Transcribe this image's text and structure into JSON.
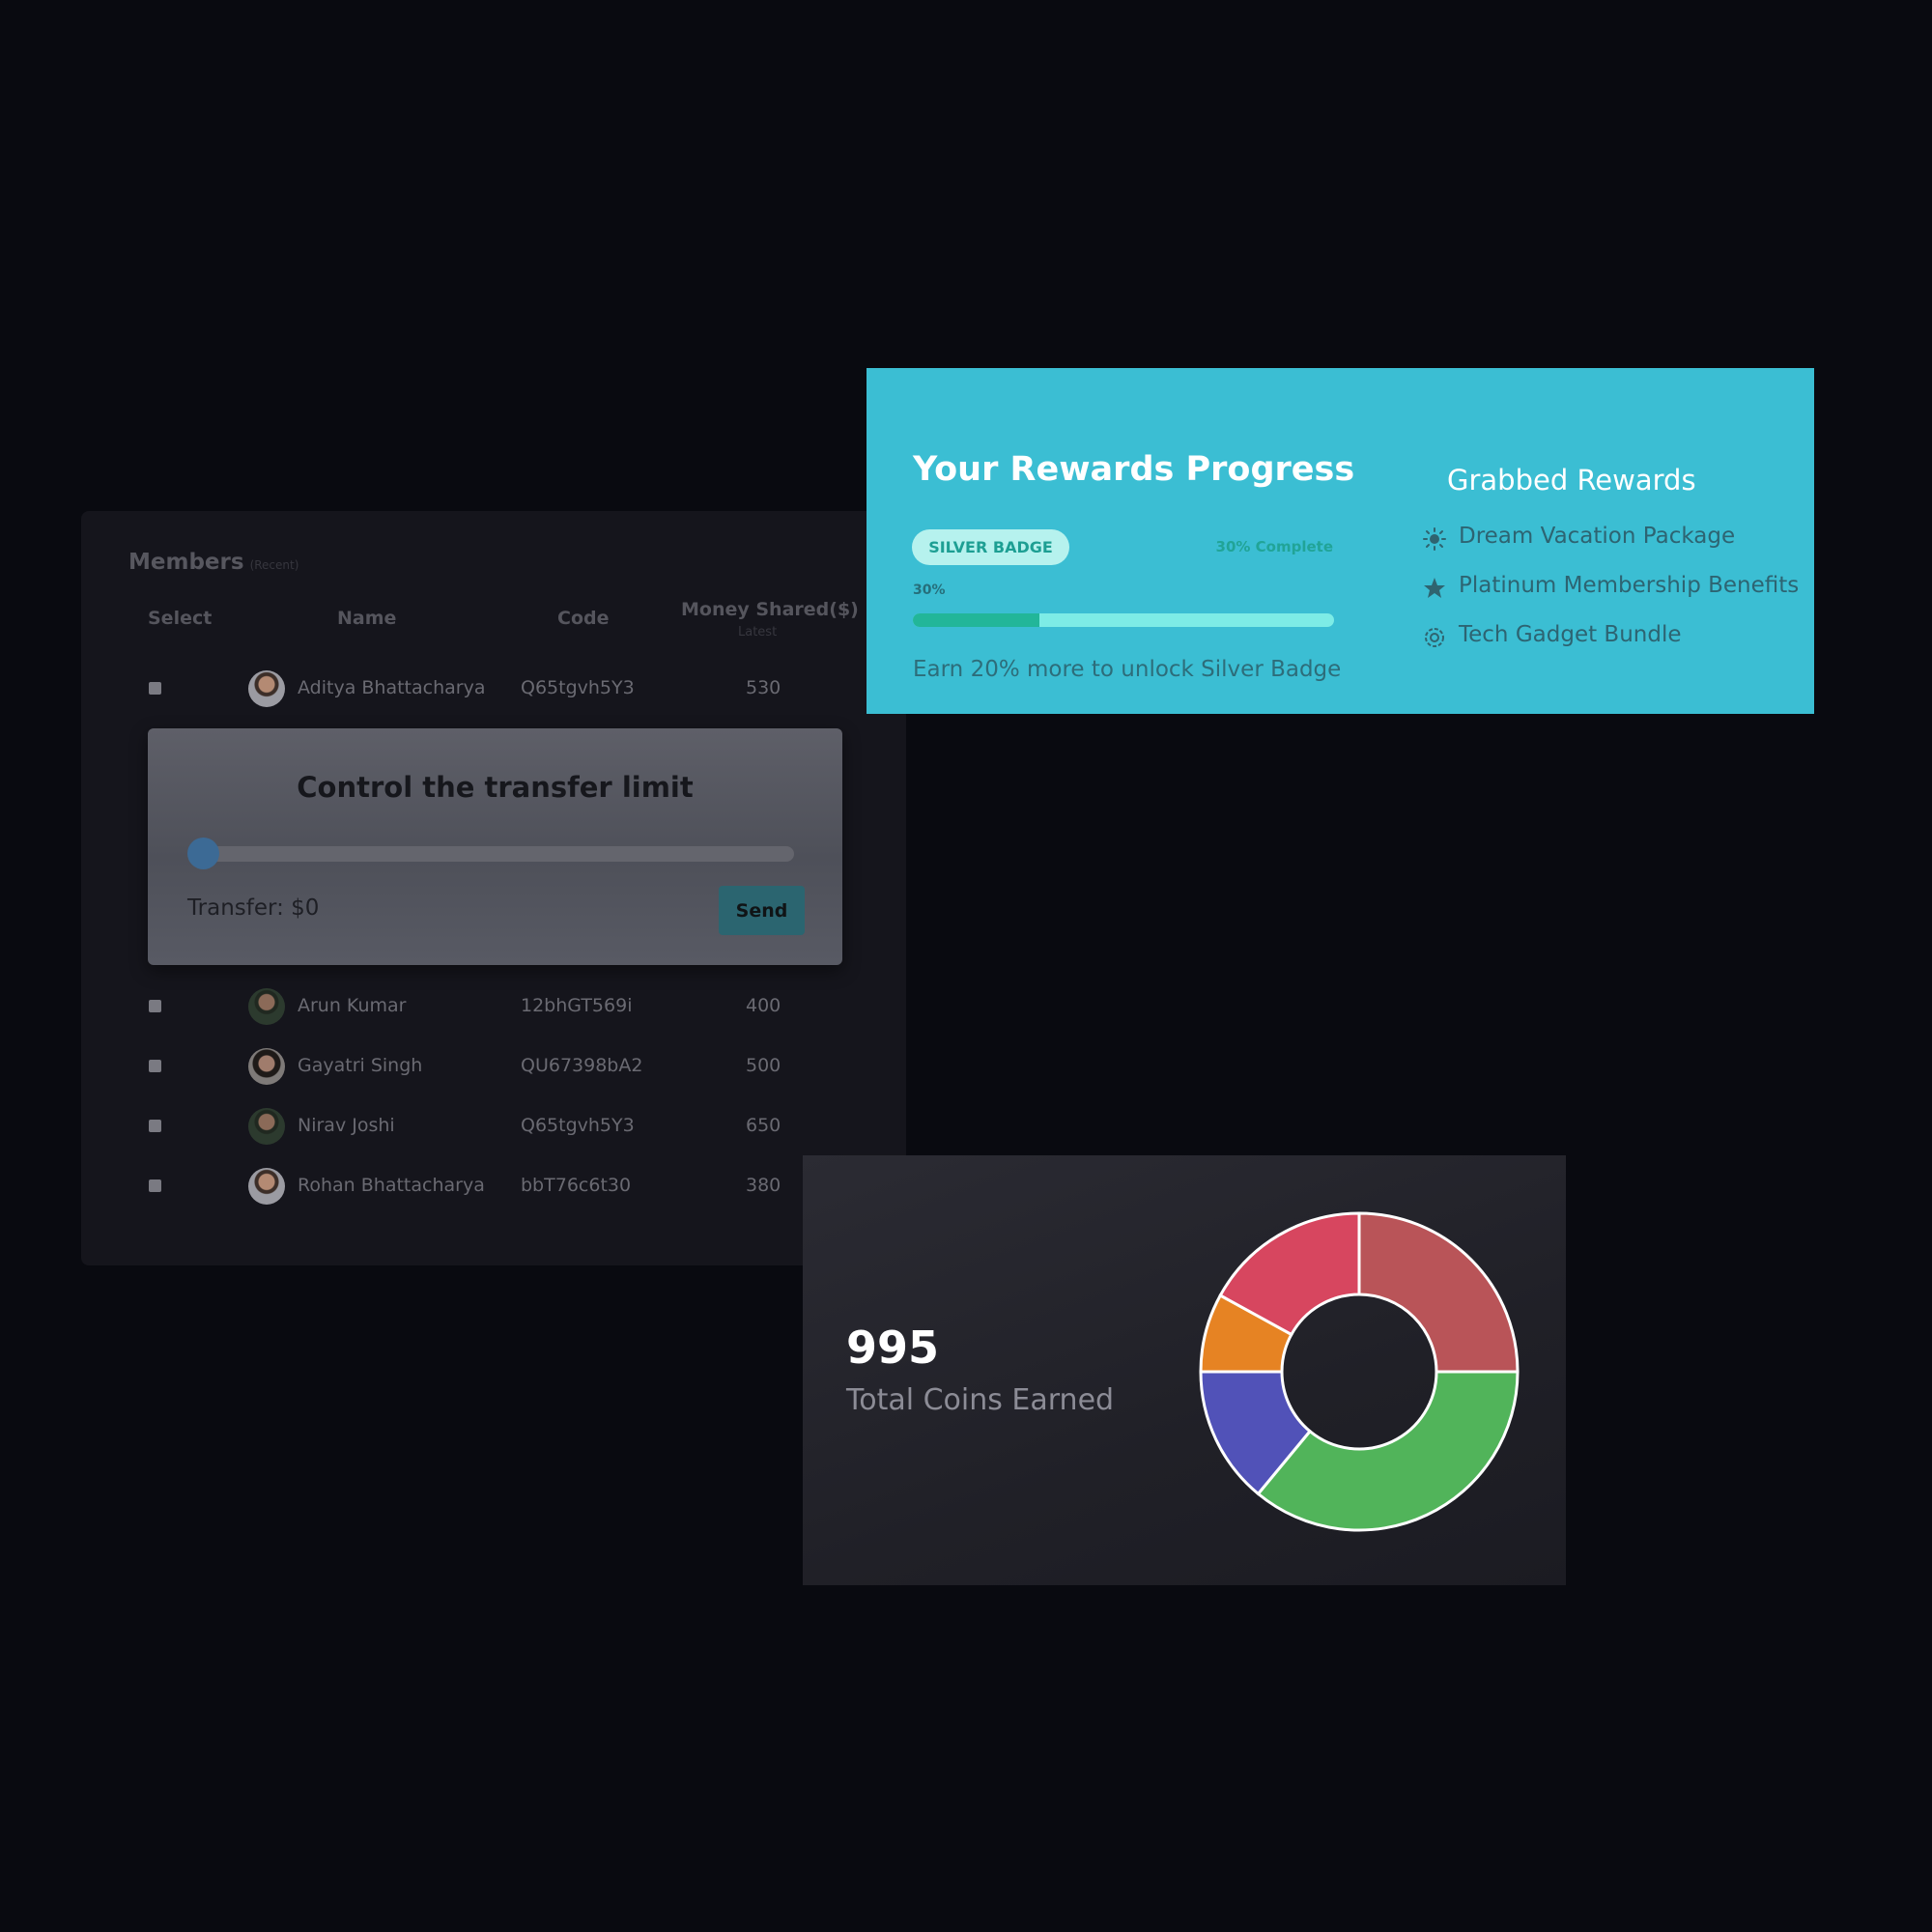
{
  "members": {
    "title": "Members",
    "subtitle": "(Recent)",
    "columns": {
      "select": "Select",
      "name": "Name",
      "code": "Code",
      "money": "Money Shared($)",
      "money_sub": "Latest"
    },
    "rows": [
      {
        "name": "Aditya Bhattacharya",
        "code": "Q65tgvh5Y3",
        "money": "530"
      },
      {
        "name": "Arun Kumar",
        "code": "12bhGT569i",
        "money": "400"
      },
      {
        "name": "Gayatri Singh",
        "code": "QU67398bA2",
        "money": "500"
      },
      {
        "name": "Nirav Joshi",
        "code": "Q65tgvh5Y3",
        "money": "650"
      },
      {
        "name": "Rohan Bhattacharya",
        "code": "bbT76c6t30",
        "money": "380"
      }
    ]
  },
  "transfer": {
    "title": "Control the transfer limit",
    "label": "Transfer: $0",
    "send_label": "Send",
    "slider_value": 0
  },
  "rewards": {
    "title": "Your Rewards Progress",
    "badge": "SILVER BADGE",
    "complete_text": "30% Complete",
    "progress_label": "30%",
    "progress": 0.3,
    "note": "Earn 20% more to unlock Silver Badge",
    "grabbed_title": "Grabbed Rewards",
    "grabbed": [
      {
        "icon": "sun-icon",
        "label": "Dream Vacation Package"
      },
      {
        "icon": "star-icon",
        "label": "Platinum Membership Benefits"
      },
      {
        "icon": "gear-icon",
        "label": "Tech Gadget Bundle"
      }
    ]
  },
  "coins": {
    "value": "995",
    "label": "Total Coins Earned"
  },
  "chart_data": {
    "type": "pie",
    "donut": true,
    "values": [
      25,
      36,
      14,
      8,
      17
    ],
    "colors": [
      "#b95458",
      "#51b45a",
      "#5152b8",
      "#e68323",
      "#d7465f"
    ]
  },
  "colors": {
    "background": "#090a10",
    "rewards_card": "#3bbed3",
    "progress_fill": "#22b699",
    "send_button": "#2b6570"
  }
}
